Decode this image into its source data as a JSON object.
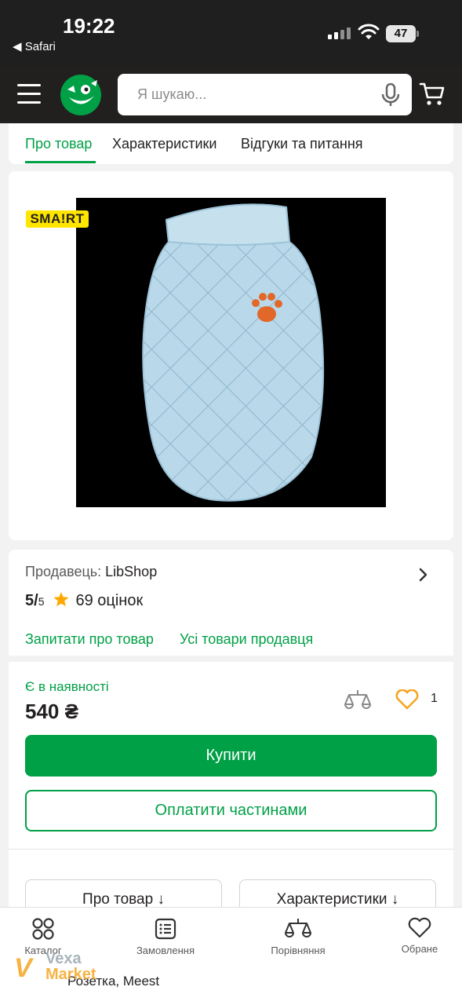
{
  "status_bar": {
    "time": "19:22",
    "back_label": "◀ Safari",
    "battery": "47"
  },
  "header": {
    "menu_icon": "hamburger-icon",
    "logo_icon": "smiley-logo-icon",
    "search_placeholder": "Я шукаю...",
    "mic_icon": "microphone-icon",
    "cart_icon": "cart-icon"
  },
  "tabs": [
    {
      "label": "Про товар",
      "active": true
    },
    {
      "label": "Характеристики",
      "active": false
    },
    {
      "label": "Відгуки та питання",
      "active": false
    }
  ],
  "product": {
    "smart_badge": "SMA!RT",
    "image_icon": "dog-jacket-image"
  },
  "seller": {
    "prefix": "Продавець: ",
    "name": "LibShop",
    "rating_value": "5/",
    "rating_max": "5",
    "reviews": "69 оцінок",
    "ask_link": "Запитати про товар",
    "all_products_link": "Усі товари продавця"
  },
  "buy": {
    "availability": "Є в наявності",
    "price": "540 ₴",
    "favorites_count": "1",
    "buy_label": "Купити",
    "installments_label": "Оплатити частинами"
  },
  "sections": {
    "about_label": "Про товар ↓",
    "specs_label": "Характеристики ↓"
  },
  "bottom_nav": [
    {
      "label": "Каталог",
      "icon": "catalog-icon"
    },
    {
      "label": "Замовлення",
      "icon": "orders-icon"
    },
    {
      "label": "Порівняння",
      "icon": "compare-icon"
    },
    {
      "label": "Обране",
      "icon": "heart-icon"
    }
  ],
  "footer": {
    "delivery": "Розетка, Meest"
  },
  "watermark": {
    "line1": "Vexa",
    "line2": "Market"
  },
  "colors": {
    "accent_green": "#00a046",
    "header_dark": "#221f1f",
    "favorite_orange": "#f5a623"
  }
}
